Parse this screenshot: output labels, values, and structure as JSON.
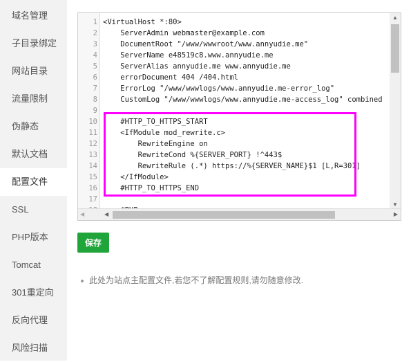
{
  "sidebar": {
    "items": [
      {
        "label": "域名管理"
      },
      {
        "label": "子目录绑定"
      },
      {
        "label": "网站目录"
      },
      {
        "label": "流量限制"
      },
      {
        "label": "伪静态"
      },
      {
        "label": "默认文档"
      },
      {
        "label": "配置文件",
        "active": true
      },
      {
        "label": "SSL"
      },
      {
        "label": "PHP版本"
      },
      {
        "label": "Tomcat"
      },
      {
        "label": "301重定向"
      },
      {
        "label": "反向代理"
      },
      {
        "label": "风险扫描"
      }
    ]
  },
  "editor": {
    "lines": [
      "<VirtualHost *:80>",
      "    ServerAdmin webmaster@example.com",
      "    DocumentRoot \"/www/wwwroot/www.annyudie.me\"",
      "    ServerName e48519c8.www.annyudie.me",
      "    ServerAlias annyudie.me www.annyudie.me",
      "    errorDocument 404 /404.html",
      "    ErrorLog \"/www/wwwlogs/www.annyudie.me-error_log\"",
      "    CustomLog \"/www/wwwlogs/www.annyudie.me-access_log\" combined",
      "",
      "    #HTTP_TO_HTTPS_START",
      "    <IfModule mod_rewrite.c>",
      "        RewriteEngine on",
      "        RewriteCond %{SERVER_PORT} !^443$",
      "        RewriteRule (.*) https://%{SERVER_NAME}$1 [L,R=301]",
      "    </IfModule>",
      "    #HTTP_TO_HTTPS_END",
      "",
      "    #PHP"
    ],
    "highlight_color": "#ff00ff"
  },
  "save_label": "保存",
  "save_color": "#20a53a",
  "note": "此处为站点主配置文件,若您不了解配置规则,请勿随意修改."
}
